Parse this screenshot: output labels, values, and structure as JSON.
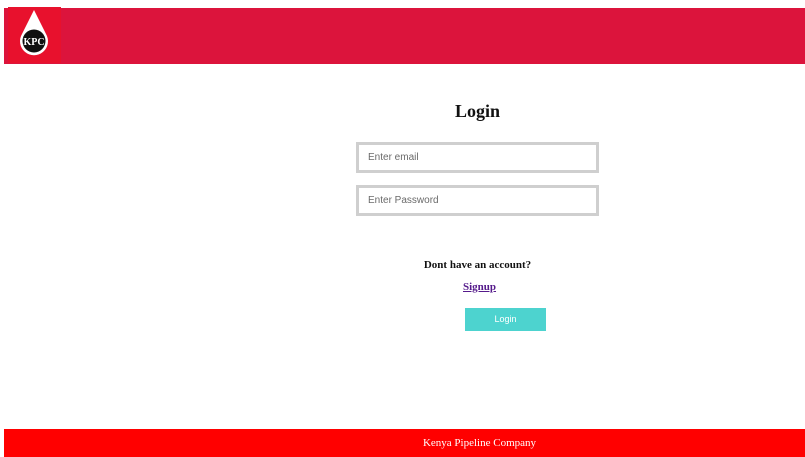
{
  "header": {
    "logo_text": "KPC",
    "color": "#dc143c"
  },
  "login": {
    "title": "Login",
    "email_placeholder": "Enter email",
    "password_placeholder": "Enter Password",
    "no_account_text": "Dont have an account?",
    "signup_label": "Signup",
    "login_button_label": "Login",
    "button_color": "#4dd3cf"
  },
  "footer": {
    "text": "Kenya Pipeline Company",
    "color": "#ff0000"
  }
}
